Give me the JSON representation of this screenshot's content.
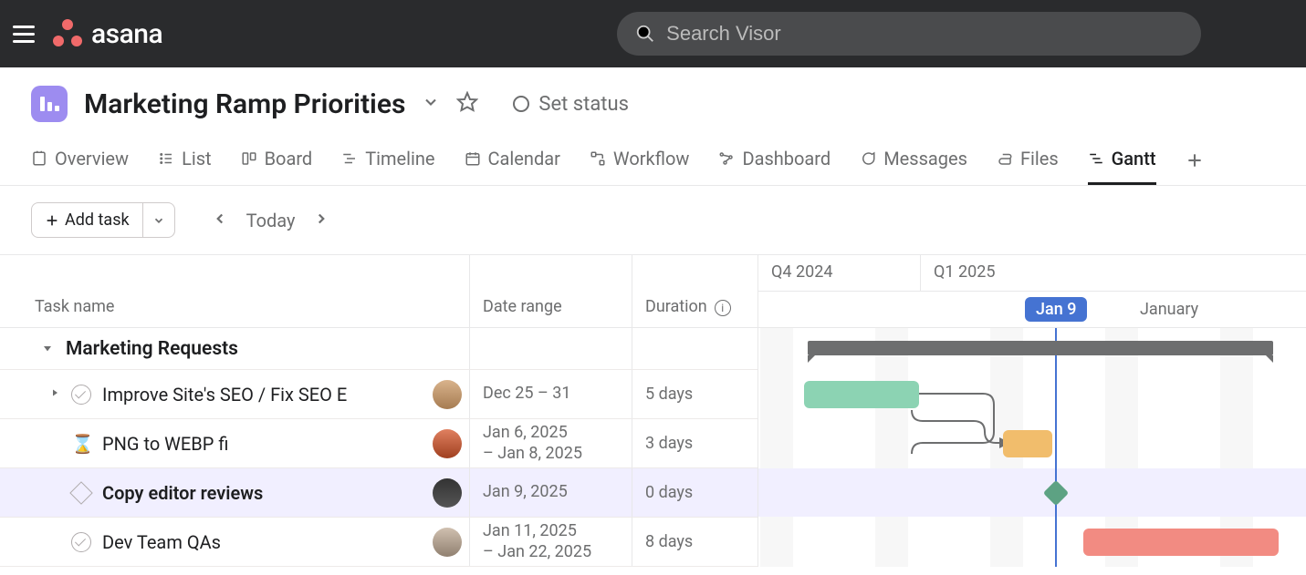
{
  "app": {
    "name": "asana"
  },
  "search": {
    "placeholder": "Search Visor"
  },
  "project": {
    "title": "Marketing Ramp Priorities",
    "set_status_label": "Set status"
  },
  "tabs": {
    "overview": "Overview",
    "list": "List",
    "board": "Board",
    "timeline": "Timeline",
    "calendar": "Calendar",
    "workflow": "Workflow",
    "dashboard": "Dashboard",
    "messages": "Messages",
    "files": "Files",
    "gantt": "Gantt"
  },
  "toolbar": {
    "add_task": "Add task",
    "today": "Today"
  },
  "columns": {
    "task_name": "Task name",
    "date_range": "Date range",
    "duration": "Duration"
  },
  "timeline": {
    "quarters": [
      "Q4 2024",
      "Q1 2025"
    ],
    "today_pill": "Jan 9",
    "month_label": "January"
  },
  "section": {
    "name": "Marketing Requests"
  },
  "tasks": [
    {
      "name": "Improve Site's SEO / Fix SEO E",
      "date_range": "Dec 25 – 31",
      "duration": "5 days",
      "icon": "check",
      "expandable": true,
      "avatar": "av1"
    },
    {
      "name": "PNG to WEBP fi",
      "date_range_l1": "Jan 6, 2025",
      "date_range_l2": "– Jan 8, 2025",
      "duration": "3 days",
      "icon": "hourglass",
      "avatar": "av2"
    },
    {
      "name": "Copy editor reviews",
      "date_range": "Jan 9, 2025",
      "duration": "0 days",
      "icon": "diamond",
      "bold": true,
      "selected": true,
      "avatar": "av3"
    },
    {
      "name": "Dev Team QAs",
      "date_range_l1": "Jan 11, 2025",
      "date_range_l2": "– Jan 22, 2025",
      "duration": "8 days",
      "icon": "check",
      "avatar": "av4"
    }
  ],
  "chart_data": {
    "type": "gantt",
    "today": "2025-01-09",
    "quarters": [
      {
        "label": "Q4 2024",
        "start": "2024-10-01"
      },
      {
        "label": "Q1 2025",
        "start": "2025-01-01"
      }
    ],
    "summary": {
      "name": "Marketing Requests",
      "start": "2024-12-25",
      "end": "2025-01-22"
    },
    "tasks": [
      {
        "name": "Improve Site's SEO / Fix SEO E",
        "start": "2024-12-25",
        "end": "2024-12-31",
        "duration_days": 5,
        "color": "green"
      },
      {
        "name": "PNG to WEBP fi",
        "start": "2025-01-06",
        "end": "2025-01-08",
        "duration_days": 3,
        "color": "orange",
        "depends_on": 0
      },
      {
        "name": "Copy editor reviews",
        "date": "2025-01-09",
        "duration_days": 0,
        "milestone": true,
        "color": "teal"
      },
      {
        "name": "Dev Team QAs",
        "start": "2025-01-11",
        "end": "2025-01-22",
        "duration_days": 8,
        "color": "red"
      }
    ]
  }
}
